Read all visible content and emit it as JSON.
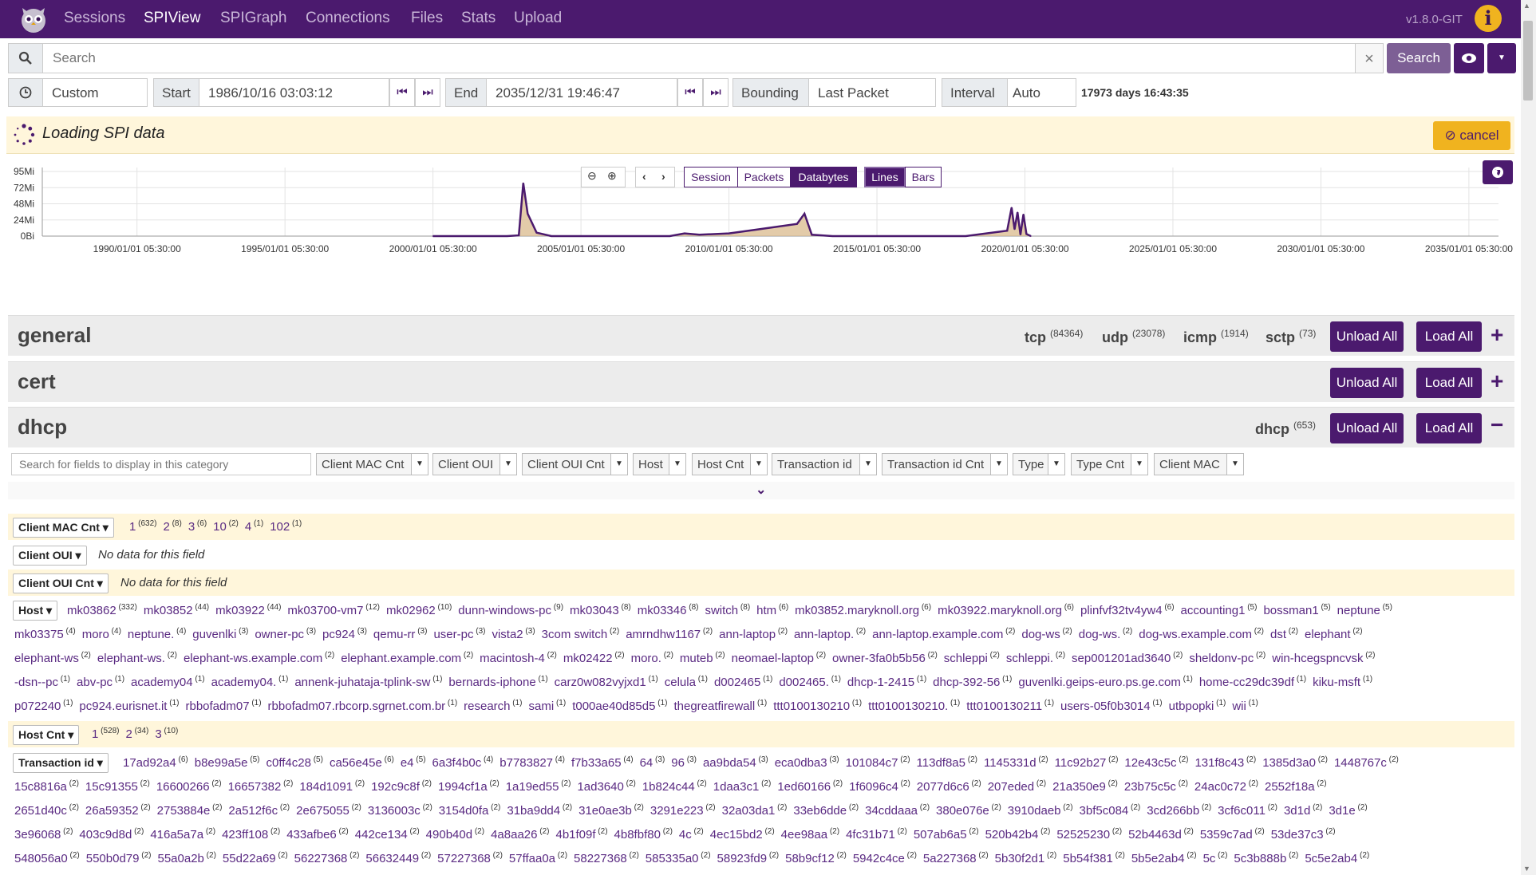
{
  "nav": {
    "items": [
      "Sessions",
      "SPIView",
      "SPIGraph",
      "Connections",
      "Files",
      "Stats",
      "Upload"
    ],
    "active": "SPIView",
    "version": "v1.8.0-GIT",
    "info_glyph": "i"
  },
  "search": {
    "placeholder": "Search",
    "button": "Search",
    "clear_glyph": "×"
  },
  "time": {
    "range": "Custom",
    "start_label": "Start",
    "start_value": "1986/10/16 03:03:12",
    "end_label": "End",
    "end_value": "2035/12/31 19:46:47",
    "bounding_label": "Bounding",
    "bounding_value": "Last Packet",
    "interval_label": "Interval",
    "interval_value": "Auto",
    "duration": "17973 days 16:43:35"
  },
  "loading": {
    "text": "Loading SPI data",
    "cancel": "cancel"
  },
  "graph": {
    "tabs": [
      "Session",
      "Packets",
      "Databytes"
    ],
    "active_tab": "Databytes",
    "styles": [
      "Lines",
      "Bars"
    ],
    "active_style": "Lines",
    "y_ticks": [
      "95Mi",
      "72Mi",
      "48Mi",
      "24Mi",
      "0Bi"
    ],
    "x_ticks": [
      "1990/01/01 05:30:00",
      "1995/01/01 05:30:00",
      "2000/01/01 05:30:00",
      "2005/01/01 05:30:00",
      "2010/01/01 05:30:00",
      "2015/01/01 05:30:00",
      "2020/01/01 05:30:00",
      "2025/01/01 05:30:00",
      "2030/01/01 05:30:00",
      "2035/01/01 05:30:00"
    ],
    "colors": {
      "line": "#4b1a6e",
      "fill": "#d9b98c"
    }
  },
  "chart_data": {
    "type": "area",
    "ylabel": "",
    "xlabel": "",
    "ylim": [
      0,
      95
    ],
    "y_unit": "Mi",
    "x": [
      2000.0,
      2002.5,
      2002.9,
      2003.05,
      2003.2,
      2003.5,
      2004.0,
      2008.0,
      2008.5,
      2009.0,
      2010.0,
      2011.0,
      2012.3,
      2012.55,
      2012.8,
      2013.5,
      2015.0,
      2018.0,
      2019.4,
      2019.55,
      2019.65,
      2019.75,
      2019.85,
      2019.95,
      2020.05,
      2020.2
    ],
    "values": [
      0,
      0,
      1,
      78,
      33,
      5,
      0,
      0,
      4,
      2,
      4,
      10,
      18,
      33,
      2,
      0,
      0,
      0,
      8,
      42,
      10,
      35,
      2,
      32,
      3,
      0
    ]
  },
  "sections": {
    "general": {
      "title": "general",
      "unload": "Unload All",
      "load": "Load All",
      "toggle": "+",
      "protocols": [
        {
          "name": "tcp",
          "count": "(84364)"
        },
        {
          "name": "udp",
          "count": "(23078)"
        },
        {
          "name": "icmp",
          "count": "(1914)"
        },
        {
          "name": "sctp",
          "count": "(73)"
        }
      ]
    },
    "cert": {
      "title": "cert",
      "unload": "Unload All",
      "load": "Load All",
      "toggle": "+"
    },
    "dhcp": {
      "title": "dhcp",
      "unload": "Unload All",
      "load": "Load All",
      "toggle": "−",
      "protocols": [
        {
          "name": "dhcp",
          "count": "(653)"
        }
      ],
      "field_search_placeholder": "Search for fields to display in this category",
      "field_selectors": [
        "Client MAC Cnt",
        "Client OUI",
        "Client OUI Cnt",
        "Host",
        "Host Cnt",
        "Transaction id",
        "Transaction id Cnt",
        "Type",
        "Type Cnt",
        "Client MAC"
      ]
    }
  },
  "fields": {
    "no_data": "No data for this field",
    "client_mac_cnt": {
      "label": "Client MAC Cnt",
      "values": [
        [
          "1",
          "(632)"
        ],
        [
          "2",
          "(8)"
        ],
        [
          "3",
          "(6)"
        ],
        [
          "10",
          "(2)"
        ],
        [
          "4",
          "(1)"
        ],
        [
          "102",
          "(1)"
        ]
      ]
    },
    "client_oui": {
      "label": "Client OUI"
    },
    "client_oui_cnt": {
      "label": "Client OUI Cnt"
    },
    "host": {
      "label": "Host",
      "line1": [
        [
          "mk03862",
          "(332)"
        ],
        [
          "mk03852",
          "(44)"
        ],
        [
          "mk03922",
          "(44)"
        ],
        [
          "mk03700-vm7",
          "(12)"
        ],
        [
          "mk02962",
          "(10)"
        ],
        [
          "dunn-windows-pc",
          "(9)"
        ],
        [
          "mk03043",
          "(8)"
        ],
        [
          "mk03346",
          "(8)"
        ],
        [
          "switch",
          "(8)"
        ],
        [
          "htm",
          "(6)"
        ],
        [
          "mk03852.maryknoll.org",
          "(6)"
        ],
        [
          "mk03922.maryknoll.org",
          "(6)"
        ],
        [
          "plinfvf32tv4yw4",
          "(6)"
        ],
        [
          "accounting1",
          "(5)"
        ],
        [
          "bossman1",
          "(5)"
        ],
        [
          "neptune",
          "(5)"
        ]
      ],
      "line2": [
        [
          "mk03375",
          "(4)"
        ],
        [
          "moro",
          "(4)"
        ],
        [
          "neptune.",
          "(4)"
        ],
        [
          "guvenlki",
          "(3)"
        ],
        [
          "owner-pc",
          "(3)"
        ],
        [
          "pc924",
          "(3)"
        ],
        [
          "qemu-rr",
          "(3)"
        ],
        [
          "user-pc",
          "(3)"
        ],
        [
          "vista2",
          "(3)"
        ],
        [
          "3com switch",
          "(2)"
        ],
        [
          "amrndhw1167",
          "(2)"
        ],
        [
          "ann-laptop",
          "(2)"
        ],
        [
          "ann-laptop.",
          "(2)"
        ],
        [
          "ann-laptop.example.com",
          "(2)"
        ],
        [
          "dog-ws",
          "(2)"
        ],
        [
          "dog-ws.",
          "(2)"
        ],
        [
          "dog-ws.example.com",
          "(2)"
        ],
        [
          "dst",
          "(2)"
        ],
        [
          "elephant",
          "(2)"
        ]
      ],
      "line3": [
        [
          "elephant-ws",
          "(2)"
        ],
        [
          "elephant-ws.",
          "(2)"
        ],
        [
          "elephant-ws.example.com",
          "(2)"
        ],
        [
          "elephant.example.com",
          "(2)"
        ],
        [
          "macintosh-4",
          "(2)"
        ],
        [
          "mk02422",
          "(2)"
        ],
        [
          "moro.",
          "(2)"
        ],
        [
          "muteb",
          "(2)"
        ],
        [
          "neomael-laptop",
          "(2)"
        ],
        [
          "owner-3fa0b5b56",
          "(2)"
        ],
        [
          "schleppi",
          "(2)"
        ],
        [
          "schleppi.",
          "(2)"
        ],
        [
          "sep001201ad3640",
          "(2)"
        ],
        [
          "sheldonv-pc",
          "(2)"
        ],
        [
          "win-hcegspncvsk",
          "(2)"
        ]
      ],
      "line4": [
        [
          "-dsn--pc",
          "(1)"
        ],
        [
          "abv-pc",
          "(1)"
        ],
        [
          "academy04",
          "(1)"
        ],
        [
          "academy04.",
          "(1)"
        ],
        [
          "annenk-juhataja-tplink-sw",
          "(1)"
        ],
        [
          "bernards-iphone",
          "(1)"
        ],
        [
          "carz0w082vyjxd1",
          "(1)"
        ],
        [
          "celula",
          "(1)"
        ],
        [
          "d002465",
          "(1)"
        ],
        [
          "d002465.",
          "(1)"
        ],
        [
          "dhcp-1-2415",
          "(1)"
        ],
        [
          "dhcp-392-56",
          "(1)"
        ],
        [
          "guvenlki.geips-euro.ps.ge.com",
          "(1)"
        ],
        [
          "home-cc29dc39df",
          "(1)"
        ],
        [
          "kiku-msft",
          "(1)"
        ]
      ],
      "line5": [
        [
          "p072240",
          "(1)"
        ],
        [
          "pc924.eurisnet.it",
          "(1)"
        ],
        [
          "rbbofadm07",
          "(1)"
        ],
        [
          "rbbofadm07.rbcorp.sgrnet.com.br",
          "(1)"
        ],
        [
          "research",
          "(1)"
        ],
        [
          "sami",
          "(1)"
        ],
        [
          "t000ae40d85d5",
          "(1)"
        ],
        [
          "thegreatfirewall",
          "(1)"
        ],
        [
          "ttt0100130210",
          "(1)"
        ],
        [
          "ttt0100130210.",
          "(1)"
        ],
        [
          "ttt0100130211",
          "(1)"
        ],
        [
          "users-05f0b3014",
          "(1)"
        ],
        [
          "utbpopki",
          "(1)"
        ],
        [
          "wii",
          "(1)"
        ]
      ]
    },
    "host_cnt": {
      "label": "Host Cnt",
      "values": [
        [
          "1",
          "(528)"
        ],
        [
          "2",
          "(34)"
        ],
        [
          "3",
          "(10)"
        ]
      ]
    },
    "transaction_id": {
      "label": "Transaction id",
      "line1": [
        [
          "17ad92a4",
          "(6)"
        ],
        [
          "b8e99a5e",
          "(5)"
        ],
        [
          "c0ff4c28",
          "(5)"
        ],
        [
          "ca56e45e",
          "(6)"
        ],
        [
          "e4",
          "(5)"
        ],
        [
          "6a3f4b0c",
          "(4)"
        ],
        [
          "b7783827",
          "(4)"
        ],
        [
          "f7b33a65",
          "(4)"
        ],
        [
          "64",
          "(3)"
        ],
        [
          "96",
          "(3)"
        ],
        [
          "aa9bda54",
          "(3)"
        ],
        [
          "eca0dba3",
          "(3)"
        ],
        [
          "101084c7",
          "(2)"
        ],
        [
          "113df8a5",
          "(2)"
        ],
        [
          "1145331d",
          "(2)"
        ],
        [
          "11c92b27",
          "(2)"
        ],
        [
          "12e43c5c",
          "(2)"
        ],
        [
          "131f8c43",
          "(2)"
        ],
        [
          "1385d3a0",
          "(2)"
        ],
        [
          "1448767c",
          "(2)"
        ]
      ],
      "line2": [
        [
          "15c8816a",
          "(2)"
        ],
        [
          "15c91355",
          "(2)"
        ],
        [
          "16600266",
          "(2)"
        ],
        [
          "16657382",
          "(2)"
        ],
        [
          "184d1091",
          "(2)"
        ],
        [
          "192c9c8f",
          "(2)"
        ],
        [
          "1994cf1a",
          "(2)"
        ],
        [
          "1a19ed55",
          "(2)"
        ],
        [
          "1ad3640",
          "(2)"
        ],
        [
          "1b824c44",
          "(2)"
        ],
        [
          "1daa3c1",
          "(2)"
        ],
        [
          "1ed60166",
          "(2)"
        ],
        [
          "1f6096c4",
          "(2)"
        ],
        [
          "2077d6c6",
          "(2)"
        ],
        [
          "207eded",
          "(2)"
        ],
        [
          "21a350e9",
          "(2)"
        ],
        [
          "23b75c5c",
          "(2)"
        ],
        [
          "24ac0c72",
          "(2)"
        ],
        [
          "2552f18a",
          "(2)"
        ]
      ],
      "line3": [
        [
          "2651d40c",
          "(2)"
        ],
        [
          "26a59352",
          "(2)"
        ],
        [
          "2753884e",
          "(2)"
        ],
        [
          "2a512f6c",
          "(2)"
        ],
        [
          "2e675055",
          "(2)"
        ],
        [
          "3136003c",
          "(2)"
        ],
        [
          "3154d0fa",
          "(2)"
        ],
        [
          "31ba9dd4",
          "(2)"
        ],
        [
          "31e0ae3b",
          "(2)"
        ],
        [
          "3291e223",
          "(2)"
        ],
        [
          "32a03da1",
          "(2)"
        ],
        [
          "33eb6dde",
          "(2)"
        ],
        [
          "34cddaaa",
          "(2)"
        ],
        [
          "380e076e",
          "(2)"
        ],
        [
          "3910daeb",
          "(2)"
        ],
        [
          "3bf5c084",
          "(2)"
        ],
        [
          "3cd266bb",
          "(2)"
        ],
        [
          "3cf6c011",
          "(2)"
        ],
        [
          "3d1d",
          "(2)"
        ],
        [
          "3d1e",
          "(2)"
        ]
      ],
      "line4": [
        [
          "3e96068",
          "(2)"
        ],
        [
          "403c9d8d",
          "(2)"
        ],
        [
          "416a5a7a",
          "(2)"
        ],
        [
          "423ff108",
          "(2)"
        ],
        [
          "433afbe6",
          "(2)"
        ],
        [
          "442ce134",
          "(2)"
        ],
        [
          "490b40d",
          "(2)"
        ],
        [
          "4a8aa26",
          "(2)"
        ],
        [
          "4b1f09f",
          "(2)"
        ],
        [
          "4b8fbf80",
          "(2)"
        ],
        [
          "4c",
          "(2)"
        ],
        [
          "4ec15bd2",
          "(2)"
        ],
        [
          "4ee98aa",
          "(2)"
        ],
        [
          "4fc31b71",
          "(2)"
        ],
        [
          "507ab6a5",
          "(2)"
        ],
        [
          "520b42b4",
          "(2)"
        ],
        [
          "52525230",
          "(2)"
        ],
        [
          "52b4463d",
          "(2)"
        ],
        [
          "5359c7ad",
          "(2)"
        ],
        [
          "53de37c3",
          "(2)"
        ]
      ],
      "line5": [
        [
          "548056a0",
          "(2)"
        ],
        [
          "550b0d79",
          "(2)"
        ],
        [
          "55a0a2b",
          "(2)"
        ],
        [
          "55d22a69",
          "(2)"
        ],
        [
          "56227368",
          "(2)"
        ],
        [
          "56632449",
          "(2)"
        ],
        [
          "57227368",
          "(2)"
        ],
        [
          "57ffaa0a",
          "(2)"
        ],
        [
          "58227368",
          "(2)"
        ],
        [
          "585335a0",
          "(2)"
        ],
        [
          "58923fd9",
          "(2)"
        ],
        [
          "58b9cf12",
          "(2)"
        ],
        [
          "5942c4ce",
          "(2)"
        ],
        [
          "5a227368",
          "(2)"
        ],
        [
          "5b30f2d1",
          "(2)"
        ],
        [
          "5b54f381",
          "(2)"
        ],
        [
          "5b5e2ab4",
          "(2)"
        ],
        [
          "5c",
          "(2)"
        ],
        [
          "5c3b888b",
          "(2)"
        ],
        [
          "5c5e2ab4",
          "(2)"
        ]
      ]
    }
  }
}
